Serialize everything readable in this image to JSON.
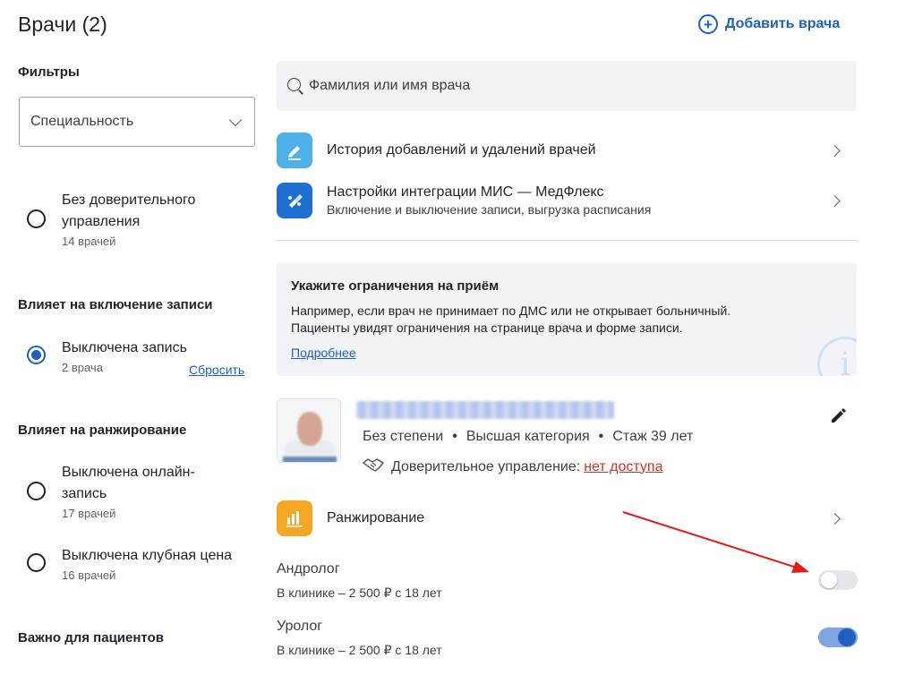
{
  "header": {
    "title": "Врачи (2)",
    "add_doctor_label": "Добавить врача"
  },
  "filters": {
    "title": "Фильтры",
    "specialty_select": "Специальность",
    "trust_group": {
      "options": [
        {
          "label": "Без доверительного управления",
          "count": "14 врачей",
          "checked": false
        }
      ]
    },
    "booking_group": {
      "title": "Влияет на включение записи",
      "options": [
        {
          "label": "Выключена запись",
          "count": "2 врача",
          "checked": true
        }
      ],
      "reset_label": "Сбросить"
    },
    "ranking_group": {
      "title": "Влияет на ранжирование",
      "options": [
        {
          "label": "Выключена онлайн-запись",
          "count": "17 врачей",
          "checked": false
        },
        {
          "label": "Выключена клубная цена",
          "count": "16 врачей",
          "checked": false
        }
      ]
    },
    "patients_group": {
      "title": "Важно для пациентов"
    }
  },
  "search": {
    "placeholder": "Фамилия или имя врача"
  },
  "nav": [
    {
      "title": "История добавлений и удалений врачей",
      "subtitle": "",
      "icon": "edit-history-icon",
      "color": "#4fb1ea"
    },
    {
      "title": "Настройки интеграции МИС — МедФлекс",
      "subtitle": "Включение и выключение записи, выгрузка расписания",
      "icon": "integration-icon",
      "color": "#1f6fd1"
    }
  ],
  "info_card": {
    "title": "Укажите ограничения на приём",
    "line1": "Например, если врач не принимает по ДМС или не открывает больничный.",
    "line2": "Пациенты увидят ограничения на странице врача и форме записи.",
    "link": "Подробнее",
    "decor_glyph": "i"
  },
  "doctor": {
    "degree": "Без степени",
    "category": "Высшая категория",
    "experience": "Стаж 39 лет",
    "trust_label": "Доверительное управление:",
    "trust_value": "нет доступа",
    "separator": "•"
  },
  "ranking": {
    "label": "Ранжирование",
    "icon_color": "#f5a623"
  },
  "services": [
    {
      "name": "Андролог",
      "price": "В клинике – 2 500 ₽ с 18 лет",
      "enabled": false
    },
    {
      "name": "Уролог",
      "price": "В клинике – 2 500 ₽ с 18 лет",
      "enabled": true
    }
  ],
  "colors": {
    "accent": "#1f5fbf",
    "danger": "#d93025",
    "annotation_arrow": "#e31b1b"
  }
}
